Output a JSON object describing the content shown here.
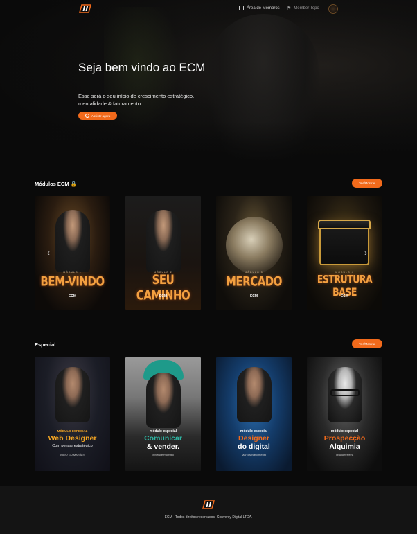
{
  "header": {
    "nav": [
      {
        "label": "Área de Membros"
      },
      {
        "label": "Member Topo"
      }
    ]
  },
  "hero": {
    "title": "Seja bem vindo ao ECM",
    "subtitle": "Esse será o seu início de crescimento estratégico, mentalidade & faturamento.",
    "button_label": "Assistir agora"
  },
  "modules": {
    "title": "Módulos ECM 🔒",
    "action_label": "Ver/Mostrar",
    "brand": "ECM",
    "items": [
      {
        "label": "MÓDULO 1",
        "title": "BEM-VINDO"
      },
      {
        "label": "MÓDULO 2",
        "title": "SEU CAMINHO"
      },
      {
        "label": "MÓDULO 3",
        "title": "MERCADO"
      },
      {
        "label": "MÓDULO 4",
        "title": "ESTRUTURA BASE"
      }
    ]
  },
  "special": {
    "title": "Especial",
    "action_label": "Ver/Mostrar",
    "items": [
      {
        "tag": "MÓDULO ESPECIAL",
        "title": "Web Designer",
        "title_color": "#f5a623",
        "subtitle": "Com pensar estratégico",
        "footer": "JULIO GUIMARÃES"
      },
      {
        "tag": "módulo especial",
        "title": "Comunicar",
        "title_color": "#2fb5a3",
        "subtitle": "& vender.",
        "footer": "@vendermonstro"
      },
      {
        "tag": "módulo especial",
        "title": "Designer",
        "title_color": "#f26a1b",
        "subtitle": "do digital",
        "footer": "Marcos Nascimento"
      },
      {
        "tag": "módulo especial",
        "title": "Prospecção",
        "title_color": "#f26a1b",
        "subtitle": "Alquimia",
        "footer": "@juliorferreira"
      }
    ]
  },
  "footer": {
    "text": "ECM - Todos direitos reservados. Conversy Digital LTDA."
  },
  "colors": {
    "accent": "#f26a1b",
    "background": "#0a0a0a",
    "footer_bg": "#141414"
  }
}
